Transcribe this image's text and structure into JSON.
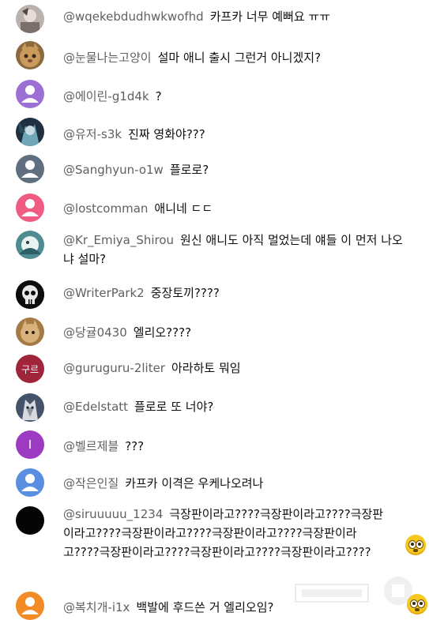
{
  "comments": [
    {
      "handle": "@wqekebdudhwkwofhd",
      "text": "카프카 너무 예뻐요 ㅠㅠ",
      "avatar": "photo-avatar"
    },
    {
      "handle": "@눈물나는고양이",
      "text": "설마 애니 출시 그런거 아니겠지?",
      "avatar": "cat-photo-avatar"
    },
    {
      "handle": "@에이린-g1d4k",
      "text": "?",
      "avatar": "default-person-avatar"
    },
    {
      "handle": "@유저-s3k",
      "text": "진짜 영화야???",
      "avatar": "photo-avatar"
    },
    {
      "handle": "@Sanghyun-o1w",
      "text": "플로로?",
      "avatar": "default-person-avatar"
    },
    {
      "handle": "@lostcomman",
      "text": "애니네 ㄷㄷ",
      "avatar": "default-person-avatar"
    },
    {
      "handle": "@Kr_Emiya_Shirou",
      "text": "원신 애니도 아직 멀었는데 얘들 이 먼저 나오냐 설마?",
      "avatar": "photo-avatar"
    },
    {
      "handle": "@WriterPark2",
      "text": "중장토끼????",
      "avatar": "skull-avatar"
    },
    {
      "handle": "@당귤0430",
      "text": "엘리오????",
      "avatar": "photo-avatar"
    },
    {
      "handle": "@guruguru-2liter",
      "text": "아라하토 뭐임",
      "avatar": "letter-avatar",
      "avatar_text": "구르"
    },
    {
      "handle": "@Edelstatt",
      "text": "플로로 또 너야?",
      "avatar": "wolf-photo-avatar"
    },
    {
      "handle": "@벨르제블",
      "text": "???",
      "avatar": "letter-avatar",
      "avatar_text": "I"
    },
    {
      "handle": "@작은인질",
      "text": "카프카 이격은 우케나오려나",
      "avatar": "default-person-avatar"
    },
    {
      "handle": "@siruuuuu_1234",
      "text": "극장판이라고????극장판이라고????극장판이라고????극장판이라고????극장판이라고????극장판이라고????극장판이라고????극장판이라고????극장판이라고????",
      "avatar": "black-avatar"
    },
    {
      "handle": "@복치개-i1x",
      "text": "백발에 후드쓴 거 엘리오임?",
      "avatar": "default-person-avatar"
    }
  ],
  "colors": {
    "handle": "#606060",
    "text": "#0f0f0f",
    "purple_default": "#9b6fd4",
    "slate_default": "#5f6f7f",
    "pink_default": "#ef5b82",
    "blue_default": "#5a8ee0",
    "orange_default": "#f28b25",
    "maroon_letter": "#a0243a",
    "violet_letter": "#9c3bc2"
  }
}
